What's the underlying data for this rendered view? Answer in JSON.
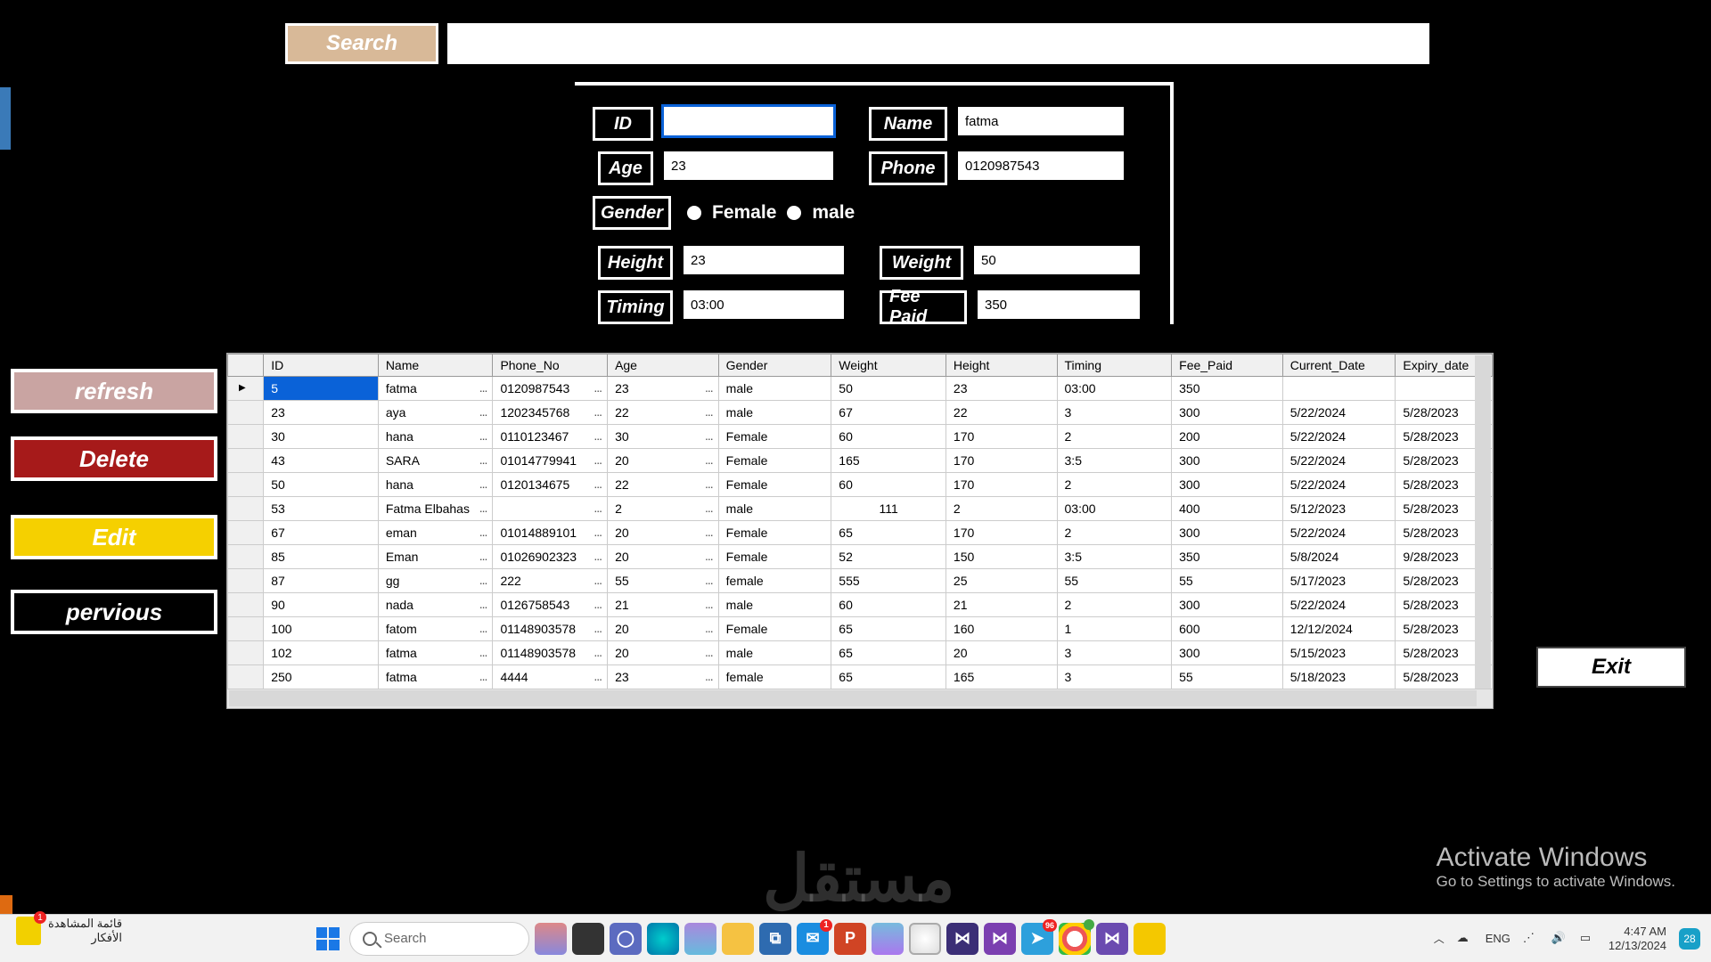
{
  "search": {
    "button": "Search",
    "value": ""
  },
  "form": {
    "id_label": "ID",
    "id_value": "",
    "name_label": "Name",
    "name_value": "fatma",
    "age_label": "Age",
    "age_value": "23",
    "phone_label": "Phone",
    "phone_value": "0120987543",
    "gender_label": "Gender",
    "female_label": "Female",
    "male_label": "male",
    "height_label": "Height",
    "height_value": "23",
    "weight_label": "Weight",
    "weight_value": "50",
    "timing_label": "Timing",
    "timing_value": "03:00",
    "fee_label": "Fee Paid",
    "fee_value": "350"
  },
  "buttons": {
    "refresh": "refresh",
    "delete": "Delete",
    "edit": "Edit",
    "previous": "pervious",
    "exit": "Exit"
  },
  "grid": {
    "columns": [
      "ID",
      "Name",
      "Phone_No",
      "Age",
      "Gender",
      "Weight",
      "Height",
      "Timing",
      "Fee_Paid",
      "Current_Date",
      "Expiry_date"
    ],
    "rows": [
      {
        "id": "5",
        "name": "fatma",
        "phone": "0120987543",
        "age": "23",
        "gender": "male",
        "weight": "50",
        "height": "23",
        "timing": "03:00",
        "fee": "350",
        "cdate": "",
        "edate": ""
      },
      {
        "id": "23",
        "name": "aya",
        "phone": "1202345768",
        "age": "22",
        "gender": "male",
        "weight": "67",
        "height": "22",
        "timing": "3",
        "fee": "300",
        "cdate": "5/22/2024",
        "edate": "5/28/2023"
      },
      {
        "id": "30",
        "name": "hana",
        "phone": "0110123467",
        "age": "30",
        "gender": "Female",
        "weight": "60",
        "height": "170",
        "timing": "2",
        "fee": "200",
        "cdate": "5/22/2024",
        "edate": "5/28/2023"
      },
      {
        "id": "43",
        "name": "SARA",
        "phone": "01014779941",
        "age": "20",
        "gender": "Female",
        "weight": "165",
        "height": "170",
        "timing": "3:5",
        "fee": "300",
        "cdate": "5/22/2024",
        "edate": "5/28/2023"
      },
      {
        "id": "50",
        "name": "hana",
        "phone": "0120134675",
        "age": "22",
        "gender": "Female",
        "weight": "60",
        "height": "170",
        "timing": "2",
        "fee": "300",
        "cdate": "5/22/2024",
        "edate": "5/28/2023"
      },
      {
        "id": "53",
        "name": "Fatma Elbahas",
        "phone": "",
        "age": "2",
        "gender": "male",
        "weight": "111",
        "height": "2",
        "timing": "03:00",
        "fee": "400",
        "cdate": "5/12/2023",
        "edate": "5/28/2023"
      },
      {
        "id": "67",
        "name": "eman",
        "phone": "01014889101",
        "age": "20",
        "gender": "Female",
        "weight": "65",
        "height": "170",
        "timing": "2",
        "fee": "300",
        "cdate": "5/22/2024",
        "edate": "5/28/2023"
      },
      {
        "id": "85",
        "name": "Eman",
        "phone": "01026902323",
        "age": "20",
        "gender": "Female",
        "weight": "52",
        "height": "150",
        "timing": "3:5",
        "fee": "350",
        "cdate": "5/8/2024",
        "edate": "9/28/2023"
      },
      {
        "id": "87",
        "name": "gg",
        "phone": "222",
        "age": "55",
        "gender": "female",
        "weight": "555",
        "height": "25",
        "timing": "55",
        "fee": "55",
        "cdate": "5/17/2023",
        "edate": "5/28/2023"
      },
      {
        "id": "90",
        "name": "nada",
        "phone": "0126758543",
        "age": "21",
        "gender": "male",
        "weight": "60",
        "height": "21",
        "timing": "2",
        "fee": "300",
        "cdate": "5/22/2024",
        "edate": "5/28/2023"
      },
      {
        "id": "100",
        "name": "fatom",
        "phone": "01148903578",
        "age": "20",
        "gender": "Female",
        "weight": "65",
        "height": "160",
        "timing": "1",
        "fee": "600",
        "cdate": "12/12/2024",
        "edate": "5/28/2023"
      },
      {
        "id": "102",
        "name": "fatma",
        "phone": "01148903578",
        "age": "20",
        "gender": "male",
        "weight": "65",
        "height": "20",
        "timing": "3",
        "fee": "300",
        "cdate": "5/15/2023",
        "edate": "5/28/2023"
      },
      {
        "id": "250",
        "name": "fatma",
        "phone": "4444",
        "age": "23",
        "gender": "female",
        "weight": "65",
        "height": "165",
        "timing": "3",
        "fee": "55",
        "cdate": "5/18/2023",
        "edate": "5/28/2023"
      }
    ]
  },
  "watermark": "مستقل",
  "activate": {
    "line1": "Activate Windows",
    "line2": "Go to Settings to activate Windows."
  },
  "taskbar": {
    "preview": {
      "line1": "قائمة المشاهدة",
      "line2": "الأفكار"
    },
    "search_placeholder": "Search",
    "lang": "ENG",
    "time": "4:47 AM",
    "date": "12/13/2024",
    "notif_count": "28"
  }
}
